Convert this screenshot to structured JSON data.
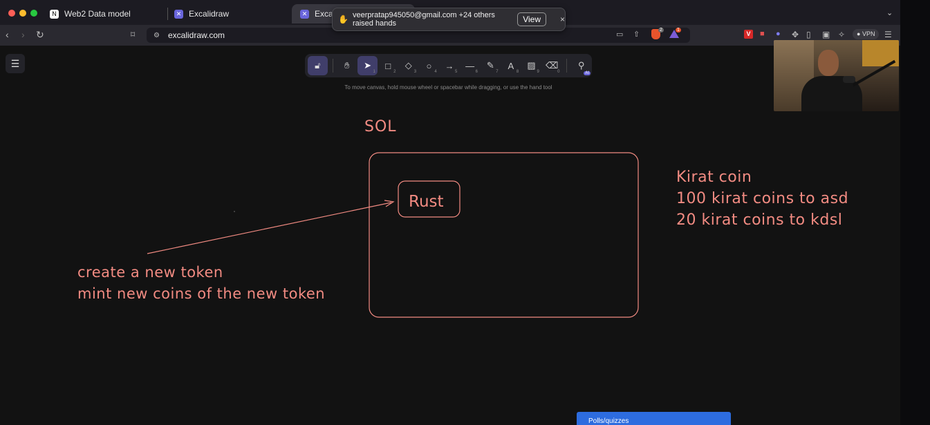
{
  "browser": {
    "tabs": [
      {
        "label": "Web2 Data model",
        "icon": "notion-icon"
      },
      {
        "label": "Excalidraw",
        "icon": "excalidraw-icon"
      },
      {
        "label": "Excalid",
        "icon": "excalidraw-icon",
        "active": true
      }
    ],
    "url": "excalidraw.com",
    "vpn_label": "VPN",
    "shield_badge": "2",
    "alert_badge": "1"
  },
  "notification": {
    "icon": "raised-hand-icon",
    "text": "veerpratap945050@gmail.com +24 others raised hands",
    "view_label": "View",
    "close_label": "×"
  },
  "toolbar": {
    "tools": [
      {
        "name": "selection",
        "icon": "pointer-icon",
        "shortcut": "1"
      },
      {
        "name": "rectangle",
        "icon": "rectangle-icon",
        "shortcut": "2"
      },
      {
        "name": "diamond",
        "icon": "diamond-icon",
        "shortcut": "3"
      },
      {
        "name": "ellipse",
        "icon": "ellipse-icon",
        "shortcut": "4"
      },
      {
        "name": "arrow",
        "icon": "arrow-icon",
        "shortcut": "5"
      },
      {
        "name": "line",
        "icon": "line-icon",
        "shortcut": "6"
      },
      {
        "name": "draw",
        "icon": "pencil-icon",
        "shortcut": "7"
      },
      {
        "name": "text",
        "icon": "text-icon",
        "shortcut": "8"
      },
      {
        "name": "image",
        "icon": "image-icon",
        "shortcut": "9"
      },
      {
        "name": "eraser",
        "icon": "eraser-icon",
        "shortcut": "0"
      }
    ],
    "ai_badge": "AI",
    "hint": "To move canvas, hold mouse wheel or spacebar while dragging, or use the hand tool"
  },
  "canvas": {
    "sol_label": "SOL",
    "rust_label": "Rust",
    "token_notes": [
      "create a new token",
      "mint new coins of the new token"
    ],
    "kirat_notes": [
      "Kirat coin",
      "100 kirat coins to asd",
      "20 kirat coins to kdsl"
    ]
  },
  "popup": {
    "label": "Polls/quizzes"
  },
  "colors": {
    "stroke": "#f28b82",
    "accent": "#403e6a",
    "poll": "#2d6cdf"
  }
}
